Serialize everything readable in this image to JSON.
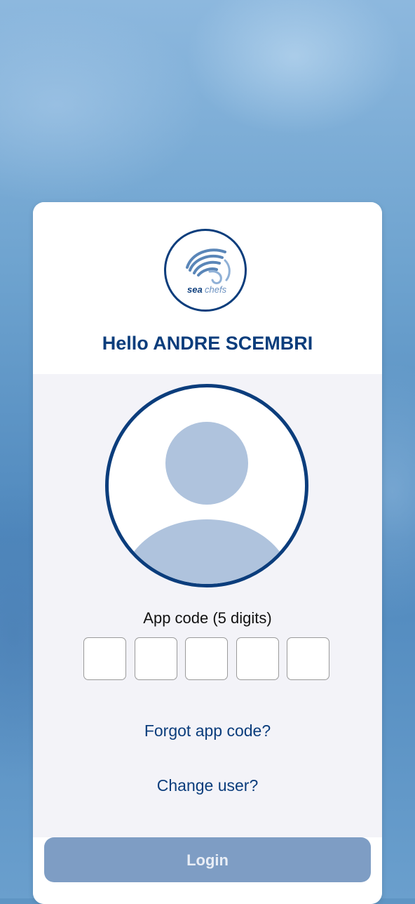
{
  "brand": {
    "logo_text_a": "sea",
    "logo_text_b": "chefs",
    "primary_color": "#0b3d7c"
  },
  "greeting": {
    "prefix": "Hello",
    "user_name": "ANDRE SCEMBRI"
  },
  "app_code": {
    "label": "App code (5 digits)",
    "digits": [
      "",
      "",
      "",
      "",
      ""
    ]
  },
  "links": {
    "forgot": "Forgot app code?",
    "change_user": "Change user?"
  },
  "login": {
    "label": "Login",
    "enabled": false
  }
}
